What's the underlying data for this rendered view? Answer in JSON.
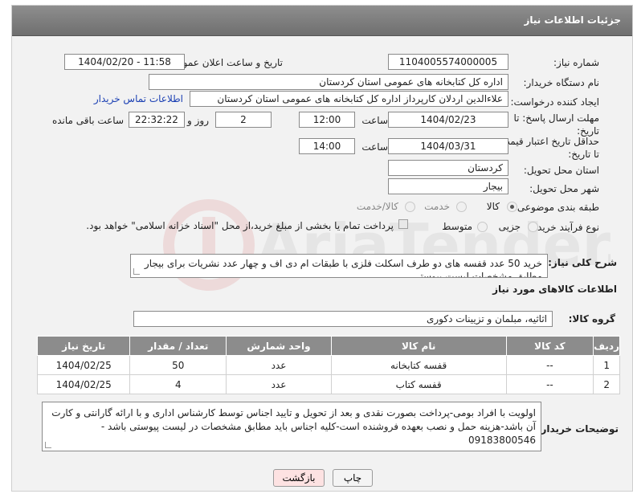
{
  "header": {
    "title": "جزئیات اطلاعات نیاز"
  },
  "fields": {
    "need_number_label": "شماره نیاز:",
    "need_number": "1104005574000005",
    "announce_label": "تاریخ و ساعت اعلان عمومی:",
    "announce_value": "1404/02/20 - 11:58",
    "buyer_org_label": "نام دستگاه خریدار:",
    "buyer_org": "اداره کل کتابخانه های عمومی استان کردستان",
    "requester_label": "ایجاد کننده درخواست:",
    "requester": "علاءالدین اردلان کارپرداز اداره کل کتابخانه های عمومی استان کردستان",
    "buyer_contact_link": "اطلاعات تماس خریدار",
    "send_deadline_label": "مهلت ارسال پاسخ: تا تاریخ:",
    "send_date": "1404/02/23",
    "time_label": "ساعت",
    "send_time": "12:00",
    "days_value": "2",
    "days_label": "روز و",
    "remaining_time": "22:32:22",
    "remaining_label": "ساعت باقی مانده",
    "price_deadline_label": "حداقل تاریخ اعتبار قیمت: تا تاریخ:",
    "price_date": "1404/03/31",
    "price_time": "14:00",
    "province_label": "استان محل تحویل:",
    "province": "کردستان",
    "city_label": "شهر محل تحویل:",
    "city": "بیجار",
    "category_label": "طبقه بندی موضوعی:",
    "category_options": [
      "کالا",
      "خدمت",
      "کالا/خدمت"
    ],
    "process_label": "نوع فرآیند خرید :",
    "process_options": [
      "جزیی",
      "متوسط"
    ],
    "payment_note": "پرداخت تمام یا بخشی از مبلغ خرید،از محل \"اسناد خزانه اسلامی\" خواهد بود.",
    "summary_label": "شرح کلی نیاز:",
    "summary": "خرید 50 عدد قفسه های دو طرف اسکلت فلزی با طبقات ام دی اف و چهار عدد نشریات برای بیجار مطابق مشخصات لیست پیوستی"
  },
  "goods": {
    "section_title": "اطلاعات کالاهای مورد نیاز",
    "group_label": "گروه کالا:",
    "group_value": "اثاثیه، مبلمان و تزیینات دکوری",
    "columns": [
      "ردیف",
      "کد کالا",
      "نام کالا",
      "واحد شمارش",
      "تعداد / مقدار",
      "تاریخ نیاز"
    ],
    "rows": [
      [
        "1",
        "--",
        "قفسه کتابخانه",
        "عدد",
        "50",
        "1404/02/25"
      ],
      [
        "2",
        "--",
        "قفسه کتاب",
        "عدد",
        "4",
        "1404/02/25"
      ]
    ]
  },
  "notes": {
    "label": "توضیحات خریدار:",
    "text": "اولویت با افراد بومی-پرداخت بصورت نقدی و بعد از تحویل و تایید اجناس توسط کارشناس اداری و با ارائه گارانتی و کارت آن باشد-هزینه حمل و نصب بعهده فروشنده است-کلیه اجناس باید مطابق مشخصات در لیست پیوستی باشد - 09183800546"
  },
  "buttons": {
    "print": "چاپ",
    "back": "بازگشت"
  },
  "watermark": "AriaTender.neT",
  "colors": {
    "header_bg": "#7f7f7f",
    "link": "#1a3fb3",
    "back_button": "#fde2e2"
  }
}
